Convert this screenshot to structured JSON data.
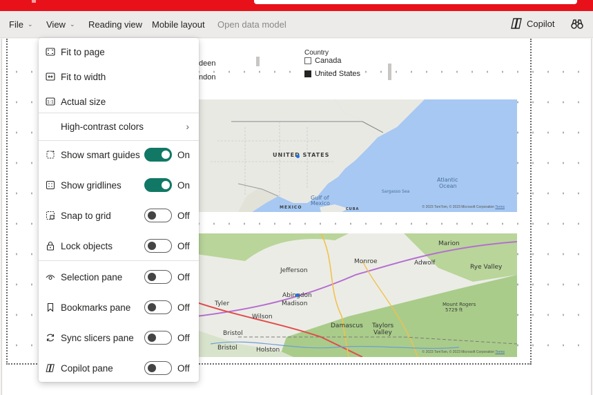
{
  "ribbon": {
    "file": "File",
    "view": "View",
    "reading_view": "Reading view",
    "mobile_layout": "Mobile layout",
    "open_data_model": "Open data model",
    "copilot": "Copilot",
    "find_icon": "binoculars-icon"
  },
  "slicer": {
    "item1_partial": "deen",
    "item2_partial": "ndon"
  },
  "legend": {
    "title": "Country",
    "items": [
      {
        "label": "Canada",
        "selected": false
      },
      {
        "label": "United States",
        "selected": true
      }
    ]
  },
  "map1": {
    "labels": {
      "country": "UNITED STATES",
      "gulf": "Gulf of\nMexico",
      "gulf1": "Gulf of",
      "gulf2": "Mexico",
      "atlantic1": "Atlantic",
      "atlantic2": "Ocean",
      "sargasso": "Sargasso Sea",
      "mexico": "MEXICO",
      "cuba": "CUBA"
    },
    "copyright": "© 2023 TomTom, © 2023 Microsoft Corporation",
    "terms": "Terms"
  },
  "map2": {
    "labels": {
      "marion": "Marion",
      "jefferson": "Jefferson",
      "monroe": "Monroe",
      "adwolf": "Adwolf",
      "rye_valley": "Rye Valley",
      "abingdon": "Abingdon",
      "madison": "Madison",
      "tyler": "Tyler",
      "wilson": "Wilson",
      "mount_rogers": "Mount Rogers",
      "mount_rogers_ft": "5729 ft",
      "damascus": "Damascus",
      "taylors": "Taylors",
      "valley": "Valley",
      "bristol1": "Bristol",
      "bristol2": "Bristol",
      "holston": "Holston"
    },
    "copyright": "© 2023 TomTom, © 2023 Microsoft Corporation",
    "terms": "Terms"
  },
  "menu": {
    "fit_to_page": "Fit to page",
    "fit_to_width": "Fit to width",
    "actual_size": "Actual size",
    "high_contrast": "High-contrast colors",
    "toggles": [
      {
        "label": "Show smart guides",
        "on": true,
        "state": "On"
      },
      {
        "label": "Show gridlines",
        "on": true,
        "state": "On"
      },
      {
        "label": "Snap to grid",
        "on": false,
        "state": "Off"
      },
      {
        "label": "Lock objects",
        "on": false,
        "state": "Off"
      },
      {
        "label": "Selection pane",
        "on": false,
        "state": "Off"
      },
      {
        "label": "Bookmarks pane",
        "on": false,
        "state": "Off"
      },
      {
        "label": "Sync slicers pane",
        "on": false,
        "state": "Off"
      },
      {
        "label": "Copilot pane",
        "on": false,
        "state": "Off"
      }
    ]
  },
  "colors": {
    "brand_red": "#e8111a",
    "toggle_on": "#117865"
  }
}
